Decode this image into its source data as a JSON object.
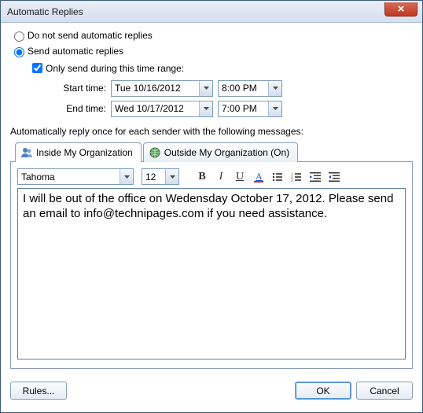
{
  "title": "Automatic Replies",
  "radios": {
    "dont_send": "Do not send automatic replies",
    "send": "Send automatic replies"
  },
  "only_send_label": "Only send during this time range:",
  "start_label": "Start time:",
  "end_label": "End time:",
  "start_date": "Tue 10/16/2012",
  "start_time": "8:00 PM",
  "end_date": "Wed 10/17/2012",
  "end_time": "7:00 PM",
  "auto_reply_label": "Automatically reply once for each sender with the following messages:",
  "tabs": {
    "inside": "Inside My Organization",
    "outside": "Outside My Organization (On)"
  },
  "font": {
    "name": "Tahoma",
    "size": "12"
  },
  "message": "I will be out of the office on Wedensday October 17, 2012. Please send an email to info@technipages.com if you need assistance.",
  "buttons": {
    "rules": "Rules...",
    "ok": "OK",
    "cancel": "Cancel"
  }
}
